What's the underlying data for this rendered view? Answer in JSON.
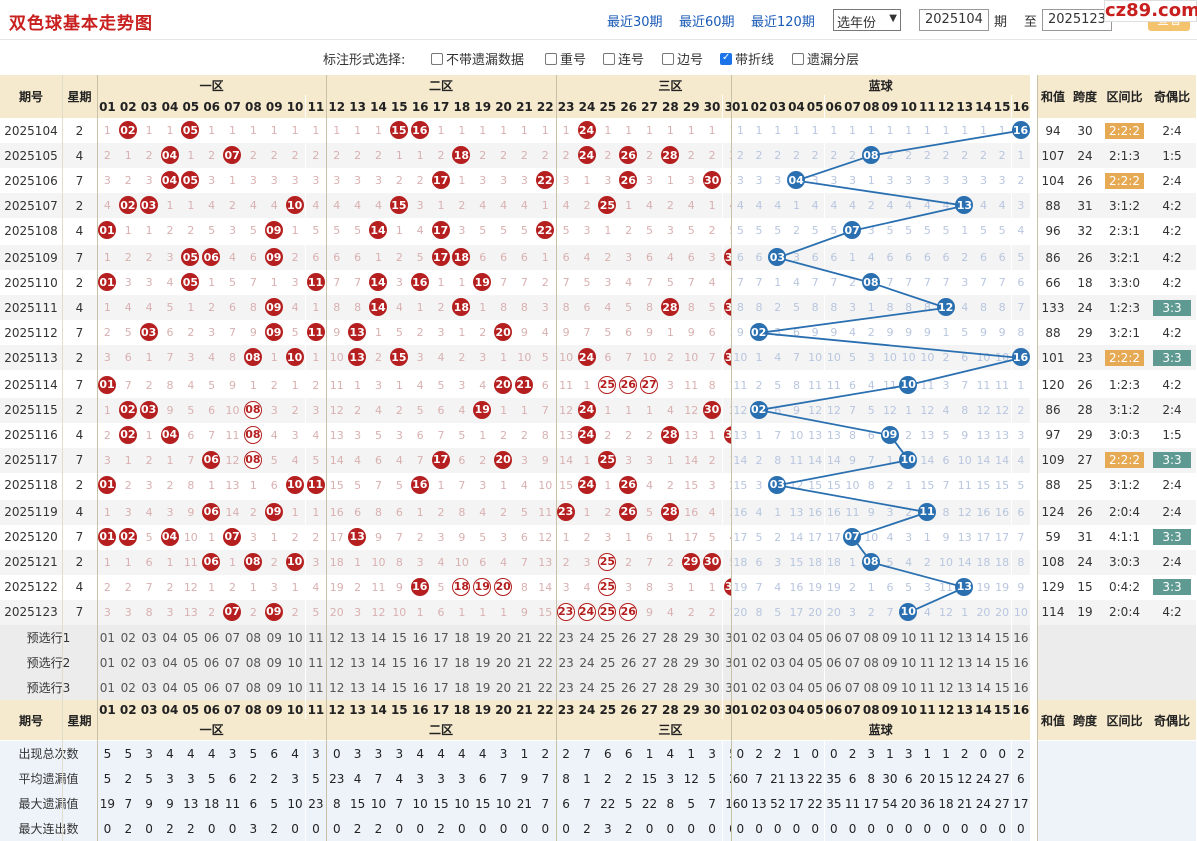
{
  "header": {
    "title": "双色球基本走势图",
    "links": [
      "最近30期",
      "最近60期",
      "最近120期"
    ],
    "year_select": "选年份",
    "from": "2025104",
    "to": "2025123",
    "qi": "期",
    "zhi": "至",
    "query": "查看",
    "logo": "cz89.com"
  },
  "options": {
    "label": "标注形式选择:",
    "items": [
      {
        "t": "不带遗漏数据",
        "on": false
      },
      {
        "t": "重号",
        "on": false
      },
      {
        "t": "连号",
        "on": false
      },
      {
        "t": "边号",
        "on": false
      },
      {
        "t": "带折线",
        "on": true
      },
      {
        "t": "遗漏分层",
        "on": false
      }
    ]
  },
  "table_header": {
    "period": "期号",
    "week": "星期",
    "zone1": "一区",
    "zone2": "二区",
    "zone3": "三区",
    "blue": "蓝球",
    "sum": "和值",
    "span": "跨度",
    "ratio": "区间比",
    "oddeven": "奇偶比"
  },
  "red_numbers": [
    "01",
    "02",
    "03",
    "04",
    "05",
    "06",
    "07",
    "08",
    "09",
    "10",
    "11",
    "12",
    "13",
    "14",
    "15",
    "16",
    "17",
    "18",
    "19",
    "20",
    "21",
    "22",
    "23",
    "24",
    "25",
    "26",
    "27",
    "28",
    "29",
    "30",
    "31",
    "32",
    "33"
  ],
  "blue_numbers": [
    "01",
    "02",
    "03",
    "04",
    "05",
    "06",
    "07",
    "08",
    "09",
    "10",
    "11",
    "12",
    "13",
    "14",
    "15",
    "16"
  ],
  "rows": [
    {
      "p": "2025104",
      "w": "2",
      "r": [
        2,
        5,
        15,
        16,
        24,
        32
      ],
      "b": 16,
      "sum": "94",
      "span": "30",
      "ratio": "2:2:2",
      "oe": "2:4",
      "ratio_hl": true,
      "oe_hl": false
    },
    {
      "p": "2025105",
      "w": "4",
      "r": [
        4,
        7,
        18,
        24,
        26,
        28
      ],
      "b": 8,
      "sum": "107",
      "span": "24",
      "ratio": "2:1:3",
      "oe": "1:5",
      "ratio_hl": false,
      "oe_hl": false
    },
    {
      "p": "2025106",
      "w": "7",
      "r": [
        4,
        5,
        17,
        22,
        26,
        30
      ],
      "b": 4,
      "sum": "104",
      "span": "26",
      "ratio": "2:2:2",
      "oe": "2:4",
      "ratio_hl": true,
      "oe_hl": false
    },
    {
      "p": "2025107",
      "w": "2",
      "r": [
        2,
        3,
        10,
        15,
        25,
        33
      ],
      "b": 13,
      "sum": "88",
      "span": "31",
      "ratio": "3:1:2",
      "oe": "4:2",
      "ratio_hl": false,
      "oe_hl": false
    },
    {
      "p": "2025108",
      "w": "4",
      "r": [
        1,
        9,
        14,
        17,
        22,
        33
      ],
      "b": 7,
      "sum": "96",
      "span": "32",
      "ratio": "2:3:1",
      "oe": "4:2",
      "ratio_hl": false,
      "oe_hl": false
    },
    {
      "p": "2025109",
      "w": "7",
      "r": [
        5,
        6,
        9,
        17,
        18,
        31
      ],
      "b": 3,
      "sum": "86",
      "span": "26",
      "ratio": "3:2:1",
      "oe": "4:2",
      "ratio_hl": false,
      "oe_hl": false
    },
    {
      "p": "2025110",
      "w": "2",
      "r": [
        1,
        5,
        11,
        14,
        16,
        19
      ],
      "b": 8,
      "sum": "66",
      "span": "18",
      "ratio": "3:3:0",
      "oe": "4:2",
      "ratio_hl": false,
      "oe_hl": false
    },
    {
      "p": "2025111",
      "w": "4",
      "r": [
        9,
        14,
        18,
        28,
        31,
        33
      ],
      "b": 12,
      "sum": "133",
      "span": "24",
      "ratio": "1:2:3",
      "oe": "3:3",
      "ratio_hl": false,
      "oe_hl": true
    },
    {
      "p": "2025112",
      "w": "7",
      "r": [
        3,
        9,
        11,
        13,
        20,
        32
      ],
      "b": 2,
      "sum": "88",
      "span": "29",
      "ratio": "3:2:1",
      "oe": "4:2",
      "ratio_hl": false,
      "oe_hl": false
    },
    {
      "p": "2025113",
      "w": "2",
      "r": [
        8,
        10,
        13,
        15,
        24,
        31
      ],
      "b": 16,
      "sum": "101",
      "span": "23",
      "ratio": "2:2:2",
      "oe": "3:3",
      "ratio_hl": true,
      "oe_hl": true
    },
    {
      "p": "2025114",
      "w": "7",
      "r": [
        1,
        20,
        21,
        25,
        26,
        27
      ],
      "b": 10,
      "sum": "120",
      "span": "26",
      "ratio": "1:2:3",
      "oe": "4:2",
      "ratio_hl": false,
      "oe_hl": false
    },
    {
      "p": "2025115",
      "w": "2",
      "r": [
        2,
        3,
        8,
        19,
        24,
        30
      ],
      "b": 2,
      "sum": "86",
      "span": "28",
      "ratio": "3:1:2",
      "oe": "2:4",
      "ratio_hl": false,
      "oe_hl": false
    },
    {
      "p": "2025116",
      "w": "4",
      "r": [
        2,
        4,
        8,
        24,
        28,
        31
      ],
      "b": 9,
      "sum": "97",
      "span": "29",
      "ratio": "3:0:3",
      "oe": "1:5",
      "ratio_hl": false,
      "oe_hl": false
    },
    {
      "p": "2025117",
      "w": "7",
      "r": [
        6,
        8,
        17,
        20,
        25,
        33
      ],
      "b": 10,
      "sum": "109",
      "span": "27",
      "ratio": "2:2:2",
      "oe": "3:3",
      "ratio_hl": true,
      "oe_hl": true
    },
    {
      "p": "2025118",
      "w": "2",
      "r": [
        1,
        10,
        11,
        16,
        24,
        26
      ],
      "b": 3,
      "sum": "88",
      "span": "25",
      "ratio": "3:1:2",
      "oe": "2:4",
      "ratio_hl": false,
      "oe_hl": false
    },
    {
      "p": "2025119",
      "w": "4",
      "r": [
        6,
        9,
        23,
        26,
        28,
        32
      ],
      "b": 11,
      "sum": "124",
      "span": "26",
      "ratio": "2:0:4",
      "oe": "2:4",
      "ratio_hl": false,
      "oe_hl": false
    },
    {
      "p": "2025120",
      "w": "7",
      "r": [
        1,
        2,
        4,
        7,
        13,
        32
      ],
      "b": 7,
      "sum": "59",
      "span": "31",
      "ratio": "4:1:1",
      "oe": "3:3",
      "ratio_hl": false,
      "oe_hl": true
    },
    {
      "p": "2025121",
      "w": "2",
      "r": [
        6,
        8,
        10,
        25,
        29,
        30
      ],
      "b": 8,
      "sum": "108",
      "span": "24",
      "ratio": "3:0:3",
      "oe": "2:4",
      "ratio_hl": false,
      "oe_hl": false
    },
    {
      "p": "2025122",
      "w": "4",
      "r": [
        16,
        18,
        19,
        20,
        25,
        31
      ],
      "b": 13,
      "sum": "129",
      "span": "15",
      "ratio": "0:4:2",
      "oe": "3:3",
      "ratio_hl": false,
      "oe_hl": true
    },
    {
      "p": "2025123",
      "w": "7",
      "r": [
        7,
        9,
        23,
        24,
        25,
        26
      ],
      "b": 10,
      "sum": "114",
      "span": "19",
      "ratio": "2:0:4",
      "oe": "4:2",
      "ratio_hl": false,
      "oe_hl": false
    }
  ],
  "outlined": {
    "2025114": [
      25,
      26,
      27
    ],
    "2025115": [
      8
    ],
    "2025116": [
      8
    ],
    "2025117": [
      8
    ],
    "2025121": [
      25
    ],
    "2025122": [
      18,
      19,
      20,
      25
    ],
    "2025123": [
      23,
      24,
      25,
      26
    ]
  },
  "preselect": [
    "预选行1",
    "预选行2",
    "预选行3"
  ],
  "stats": [
    {
      "label": "出现总次数",
      "red": [
        "5",
        "5",
        "3",
        "4",
        "4",
        "4",
        "3",
        "5",
        "6",
        "4",
        "3",
        "0",
        "3",
        "3",
        "3",
        "4",
        "4",
        "4",
        "4",
        "3",
        "1",
        "2",
        "2",
        "7",
        "6",
        "6",
        "1",
        "4",
        "1",
        "3",
        "5",
        "4",
        "4"
      ],
      "blue": [
        "0",
        "2",
        "2",
        "1",
        "0",
        "0",
        "2",
        "3",
        "1",
        "3",
        "1",
        "1",
        "2",
        "0",
        "0",
        "2"
      ]
    },
    {
      "label": "平均遗漏值",
      "red": [
        "5",
        "2",
        "5",
        "3",
        "3",
        "5",
        "6",
        "2",
        "2",
        "3",
        "5",
        "23",
        "4",
        "7",
        "4",
        "3",
        "3",
        "3",
        "6",
        "7",
        "9",
        "7",
        "8",
        "1",
        "2",
        "2",
        "15",
        "3",
        "12",
        "5",
        "2",
        "3",
        "6"
      ],
      "blue": [
        "60",
        "7",
        "21",
        "13",
        "22",
        "35",
        "6",
        "8",
        "30",
        "6",
        "20",
        "15",
        "12",
        "24",
        "27",
        "6"
      ]
    },
    {
      "label": "最大遗漏值",
      "red": [
        "19",
        "7",
        "9",
        "9",
        "13",
        "18",
        "11",
        "6",
        "5",
        "10",
        "23",
        "8",
        "15",
        "10",
        "7",
        "10",
        "15",
        "10",
        "15",
        "10",
        "21",
        "7",
        "6",
        "7",
        "22",
        "5",
        "22",
        "8",
        "5",
        "7",
        "15",
        "15",
        "15"
      ],
      "blue": [
        "60",
        "13",
        "52",
        "17",
        "22",
        "35",
        "11",
        "17",
        "54",
        "20",
        "36",
        "18",
        "21",
        "24",
        "27",
        "17"
      ]
    },
    {
      "label": "最大连出数",
      "red": [
        "0",
        "2",
        "0",
        "2",
        "2",
        "0",
        "0",
        "3",
        "2",
        "0",
        "0",
        "0",
        "2",
        "2",
        "0",
        "0",
        "2",
        "0",
        "0",
        "0",
        "0",
        "0",
        "0",
        "2",
        "3",
        "2",
        "0",
        "0",
        "0",
        "0",
        "0",
        "2",
        "2"
      ],
      "blue": [
        "0",
        "0",
        "0",
        "0",
        "0",
        "0",
        "0",
        "0",
        "0",
        "0",
        "0",
        "0",
        "0",
        "0",
        "0",
        "0"
      ]
    }
  ]
}
